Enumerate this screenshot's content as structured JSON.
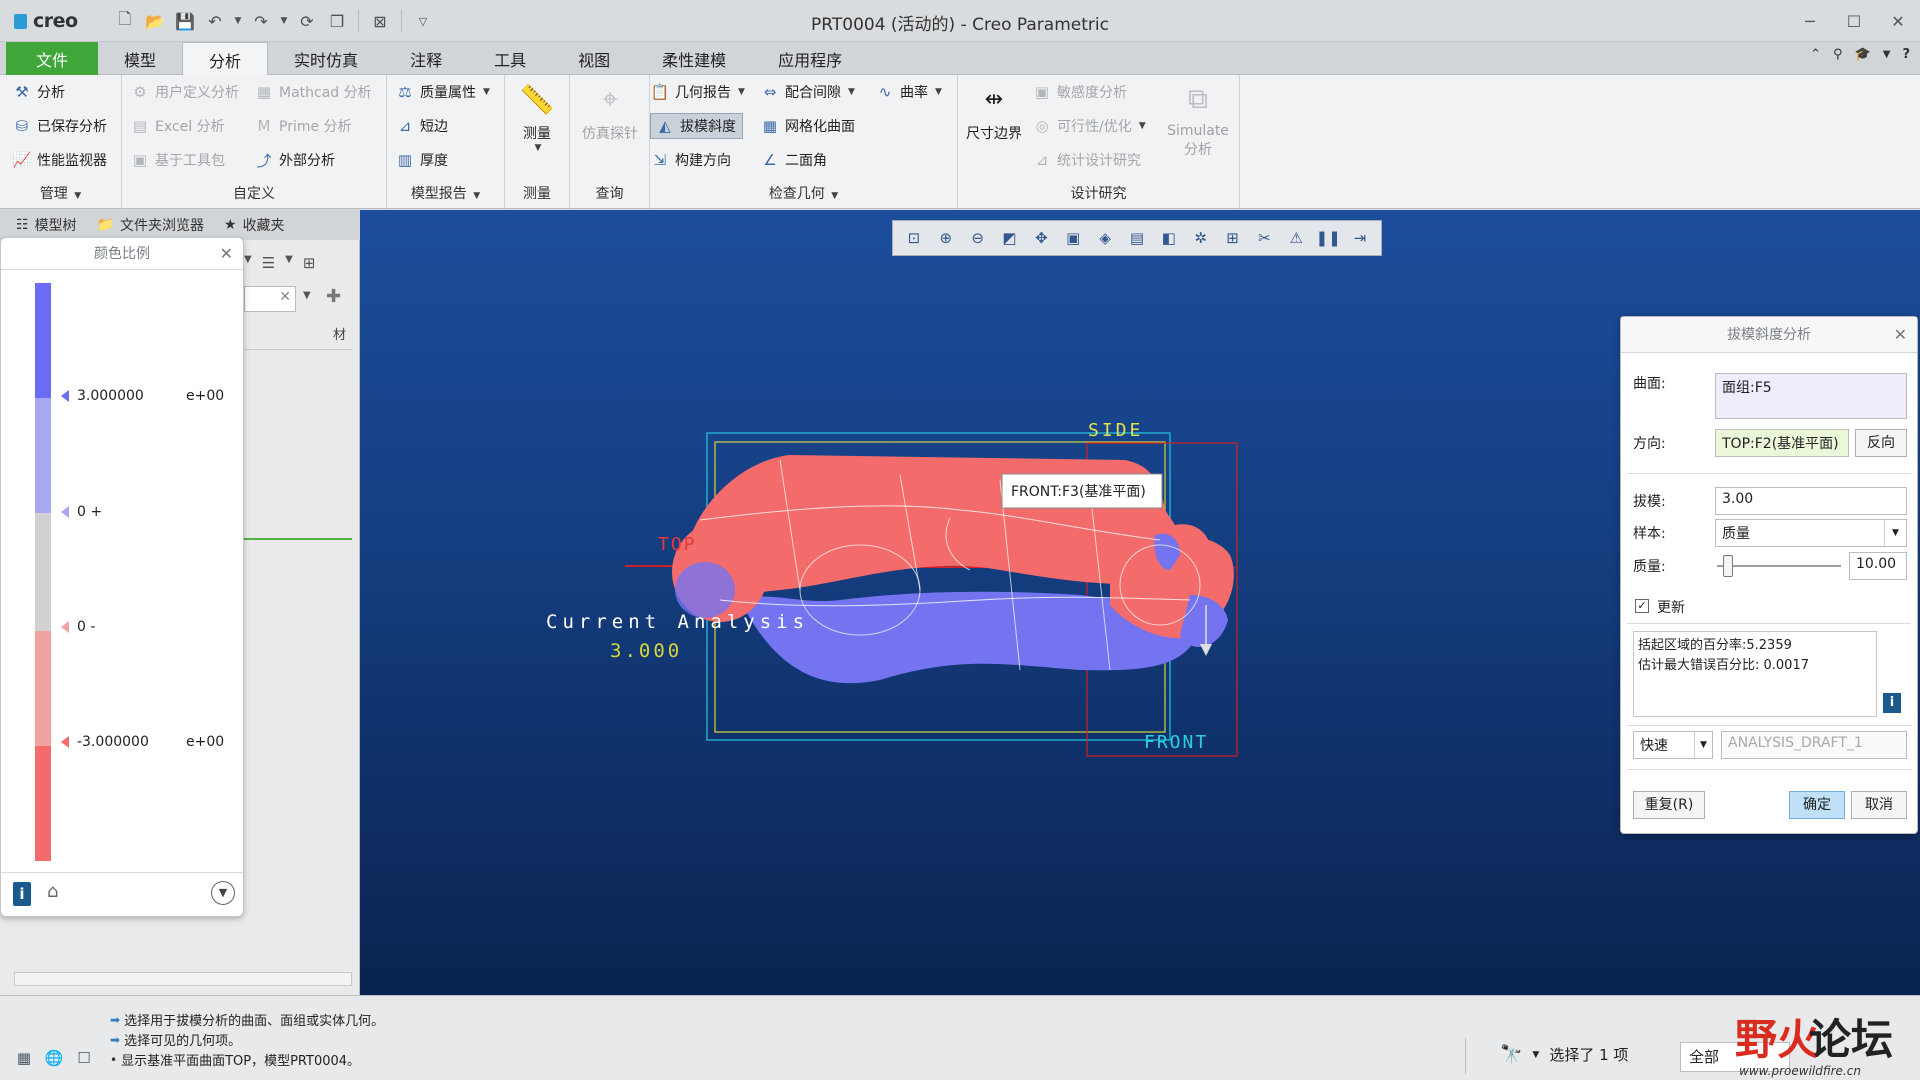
{
  "window": {
    "logo": "creo",
    "title": "PRT0004 (活动的) - Creo Parametric"
  },
  "menu": {
    "tabs": [
      "文件",
      "模型",
      "分析",
      "实时仿真",
      "注释",
      "工具",
      "视图",
      "柔性建模",
      "应用程序"
    ],
    "active_index": 2
  },
  "ribbon": {
    "manage": {
      "items": [
        "分析",
        "已保存分析",
        "性能监视器"
      ],
      "label": "管理"
    },
    "custom": {
      "items": [
        "用户定义分析",
        "Mathcad 分析",
        "Excel 分析",
        "Prime 分析",
        "基于工具包",
        "外部分析"
      ],
      "label": "自定义"
    },
    "model_report": {
      "items": [
        "质量属性",
        "短边",
        "厚度"
      ],
      "label": "模型报告"
    },
    "measure": {
      "big": "测量",
      "label": "测量"
    },
    "query": {
      "big": "仿真探针",
      "label": "查询"
    },
    "inspect": {
      "items": [
        "几何报告",
        "配合间隙",
        "曲率",
        "拔模斜度",
        "网格化曲面",
        "构建方向",
        "二面角"
      ],
      "label": "检查几何"
    },
    "design": {
      "dim_boundary": "尺寸边界",
      "items": [
        "敏感度分析",
        "可行性/优化",
        "统计设计研究"
      ],
      "simulate_1": "Simulate",
      "simulate_2": "分析",
      "label": "设计研究"
    }
  },
  "left_panel": {
    "tabs": [
      "模型树",
      "文件夹浏览器",
      "收藏夹"
    ],
    "column_header": "材"
  },
  "color_scale": {
    "title": "颜色比例",
    "labels": [
      {
        "value": "3.000000",
        "exp": "e+00"
      },
      {
        "value": "0 +",
        "exp": ""
      },
      {
        "value": "0 -",
        "exp": ""
      },
      {
        "value": "-3.000000",
        "exp": "e+00"
      }
    ],
    "colors": {
      "blue_strong": "#6b6bf3",
      "blue_light": "#a8a8f0",
      "neutral": "#d1d1d1",
      "red_light": "#f0a3a3",
      "red_strong": "#f56a6a"
    }
  },
  "viewport": {
    "labels": {
      "side": "SIDE",
      "top": "TOP",
      "front": "FRONT",
      "analysis": "Current Analysis",
      "analysis_value": "3.000",
      "tooltip": "FRONT:F3(基准平面)"
    },
    "colors": {
      "bg_top": "#1c4d9c",
      "bg_bottom": "#0a2350",
      "red": "#f36b6b",
      "blue": "#7474f0"
    }
  },
  "draft_dialog": {
    "title": "拔模斜度分析",
    "surface_label": "曲面:",
    "surface_value": "面组:F5",
    "direction_label": "方向:",
    "direction_value": "TOP:F2(基准平面)",
    "reverse": "反向",
    "draft_label": "拔模:",
    "draft_value": "3.00",
    "sample_label": "样本:",
    "sample_value": "质量",
    "quality_label": "质量:",
    "quality_value": "10.00",
    "quality_level": 0.05,
    "update_label": "更新",
    "result_1": "括起区域的百分率:5.2359",
    "result_2": "估计最大错误百分比: 0.0017",
    "mode": "快速",
    "analysis_name": "ANALYSIS_DRAFT_1",
    "repeat": "重复(R)",
    "ok": "确定",
    "cancel": "取消"
  },
  "status": {
    "messages": [
      "选择用于拔模分析的曲面、面组或实体几何。",
      "选择可见的几何项。",
      "显示基准平面曲面TOP，模型PRT0004。"
    ],
    "selected": "选择了 1 项",
    "filter": "全部"
  },
  "watermark": {
    "text_red": "野火",
    "text_black": "论坛",
    "url": "www.proewildfire.cn"
  }
}
